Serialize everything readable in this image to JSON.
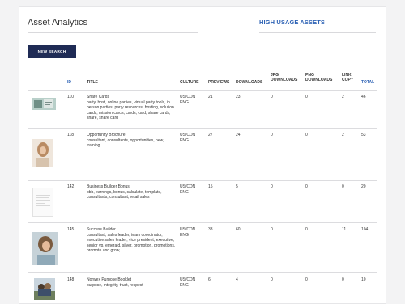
{
  "page": {
    "title": "Asset Analytics",
    "high_usage_title": "HIGH USAGE ASSETS",
    "new_search_label": "NEW SEARCH"
  },
  "table": {
    "headers": {
      "id": "ID",
      "title": "TITLE",
      "culture": "CULTURE",
      "previews": "PREVIEWS",
      "downloads": "DOWNLOADS",
      "jpg": "JPG\nDOWNLOADS",
      "png": "PNG\nDOWNLOADS",
      "link": "LINK\nCOPY",
      "total": "TOTAL"
    },
    "rows": [
      {
        "id": "110",
        "title": "Share Cards",
        "tags": "party, host, online parties, virtual party tools, in person parties, party resources, hosting, solution cards, mission cards, cards, card, share cards, share, share card",
        "culture": "US/CDN\nENG",
        "previews": "21",
        "downloads": "23",
        "jpg": "0",
        "png": "0",
        "link": "2",
        "total": "46"
      },
      {
        "id": "118",
        "title": "Opportunity Brochure",
        "tags": "consultant, consultants, opportunities, new, training",
        "culture": "US/CDN\nENG",
        "previews": "27",
        "downloads": "24",
        "jpg": "0",
        "png": "0",
        "link": "2",
        "total": "53"
      },
      {
        "id": "142",
        "title": "Business Builder Bonus",
        "tags": "bbb, earnings, bonus, calculate, template, consultants, consultant, retail sales",
        "culture": "US/CDN\nENG",
        "previews": "15",
        "downloads": "5",
        "jpg": "0",
        "png": "0",
        "link": "0",
        "total": "20"
      },
      {
        "id": "145",
        "title": "Success Builder",
        "tags": "consultant, sales leader, team coordinator, executive sales leader, vice president, executive, senior vp, emerald, silver, promotion, promotions, promote and grow,",
        "culture": "US/CDN\nENG",
        "previews": "33",
        "downloads": "60",
        "jpg": "0",
        "png": "0",
        "link": "11",
        "total": "104"
      },
      {
        "id": "148",
        "title": "Norwex Purpose Booklet",
        "tags": "purpose, integrity, trust, respect",
        "culture": "US/CDN\nENG",
        "previews": "6",
        "downloads": "4",
        "jpg": "0",
        "png": "0",
        "link": "0",
        "total": "10"
      }
    ]
  },
  "thumbnails": [
    "share-cards-thumbnail",
    "opportunity-brochure-thumbnail",
    "business-builder-bonus-thumbnail",
    "success-builder-thumbnail",
    "purpose-booklet-thumbnail"
  ]
}
